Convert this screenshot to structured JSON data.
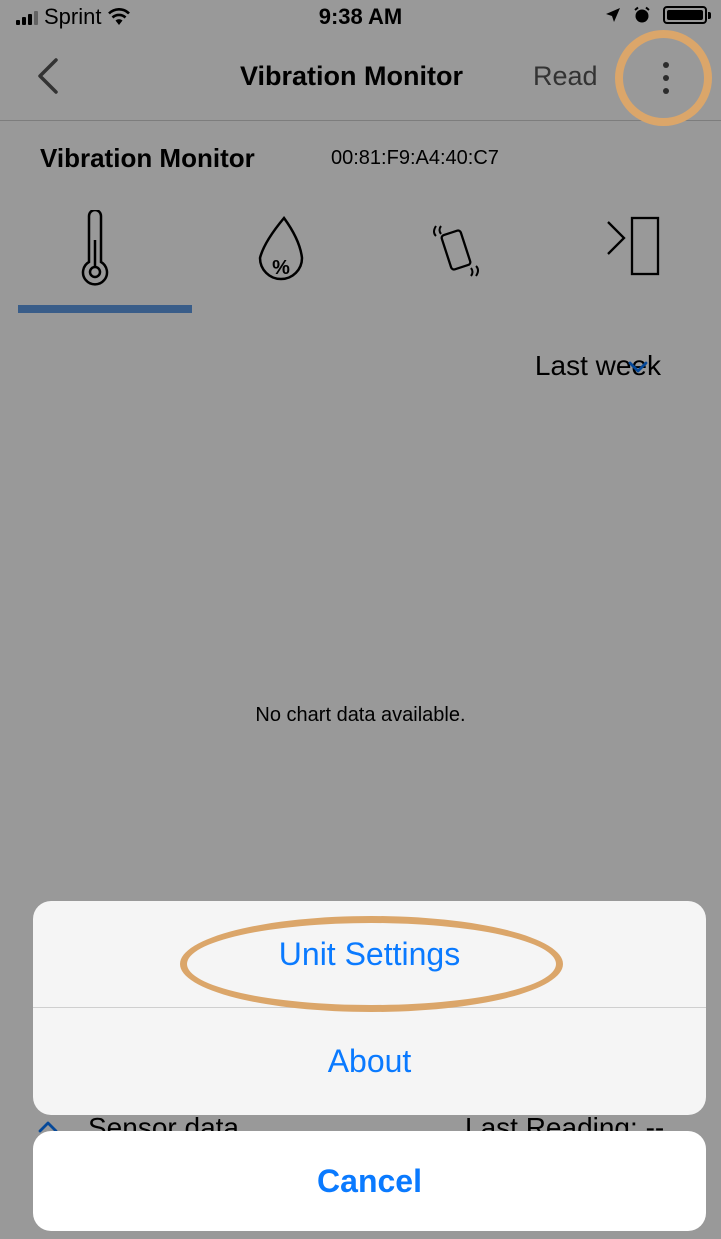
{
  "status_bar": {
    "carrier": "Sprint",
    "time": "9:38 AM"
  },
  "nav": {
    "title": "Vibration Monitor",
    "action": "Read"
  },
  "device": {
    "name": "Vibration Monitor",
    "mac": "00:81:F9:A4:40:C7"
  },
  "tabs": [
    {
      "icon": "thermometer-icon",
      "selected": true
    },
    {
      "icon": "humidity-drop-icon",
      "selected": false
    },
    {
      "icon": "vibration-phone-icon",
      "selected": false
    },
    {
      "icon": "door-sensor-icon",
      "selected": false
    }
  ],
  "period": {
    "selected": "Last week"
  },
  "chart": {
    "empty_message": "No chart data available."
  },
  "footer": {
    "left": "Sensor data",
    "right": "Last Reading: --"
  },
  "action_sheet": {
    "items": [
      "Unit Settings",
      "About"
    ],
    "cancel": "Cancel"
  },
  "colors": {
    "accent": "#0a7aff",
    "tab_indicator": "#5f9be5",
    "highlight": "#dba66a"
  }
}
